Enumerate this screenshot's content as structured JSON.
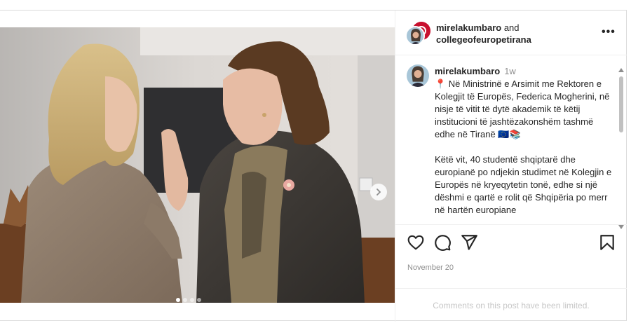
{
  "post": {
    "author_primary": "mirelakumbaro",
    "header_and": "and",
    "author_secondary": "collegeofeuropetirana",
    "more_label": "•••",
    "caption": {
      "username": "mirelakumbaro",
      "time": "1w",
      "paragraph_1": "📍 Në Ministrinë e Arsimit me Rektoren e Kolegjit të Europës, Federica Mogherini, në nisje të vitit të dytë akademik të këtij institucioni të jashtëzakonshëm tashmë edhe në Tiranë 🇪🇺📚",
      "paragraph_2": "Këtë vit, 40 studentë shqiptarë dhe europianë po ndjekin studimet në Kolegjin e Europës në kryeqytetin tonë, edhe si një dëshmi e qartë e rolit që Shqipëria po merr në hartën europiane"
    },
    "date": "November 20",
    "comments_limited": "Comments on this post have been limited.",
    "carousel": {
      "total": 4,
      "active": 1
    }
  },
  "colors": {
    "border": "#dbdbdb",
    "secondary_text": "#8e8e8e",
    "primary_text": "#262626"
  },
  "icons": [
    "like-icon",
    "comment-icon",
    "share-icon",
    "save-icon",
    "chevron-right-icon",
    "tag-person-icon"
  ]
}
